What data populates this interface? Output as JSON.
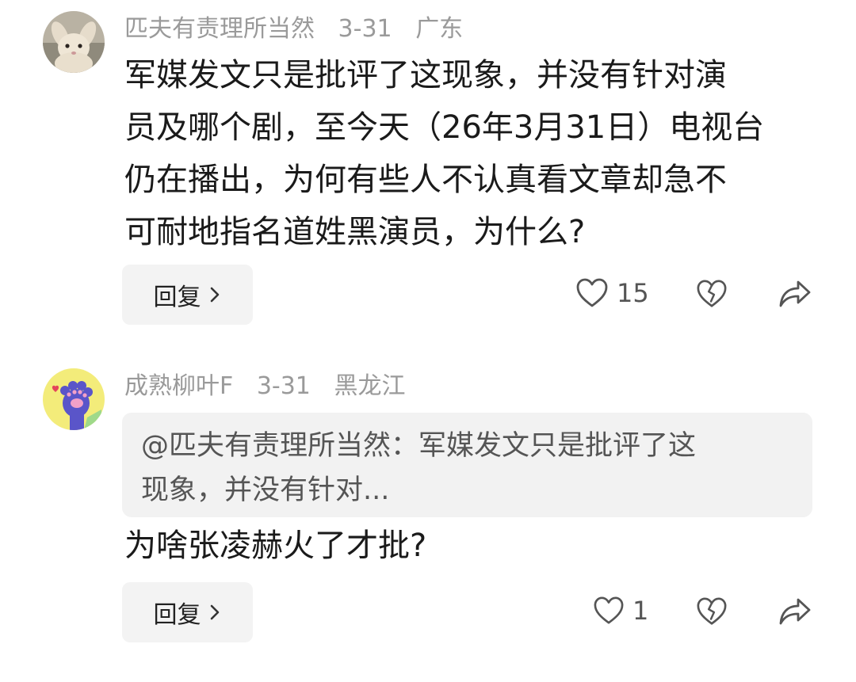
{
  "comments": [
    {
      "username": "匹夫有责理所当然",
      "date": "3-31",
      "location": "广东",
      "lines": [
        "军媒发文只是批评了这现象，并没有针对演",
        "员及哪个剧，至今天（26年3月31日）电视台",
        "仍在播出，为何有些人不认真看文章却急不",
        "可耐地指名道姓黑演员，为什么?"
      ],
      "reply_label": "回复",
      "like_count": "15",
      "avatar": "rabbit-photo"
    },
    {
      "username": "成熟柳叶F",
      "date": "3-31",
      "location": "黑龙江",
      "quote_lines": [
        "@匹夫有责理所当然：军媒发文只是批评了这",
        "现象，并没有针对..."
      ],
      "text": "为啥张凌赫火了才批?",
      "reply_label": "回复",
      "like_count": "1",
      "avatar": "paw-illustration"
    }
  ],
  "icons": {
    "like": "heart-outline-icon",
    "dislike": "broken-heart-icon",
    "share": "share-arrow-icon",
    "chevron": "chevron-right-icon"
  },
  "colors": {
    "meta_text": "#9a9a9a",
    "body_text": "#1a1a1a",
    "quote_bg": "#f2f2f2",
    "button_bg": "#f3f3f3",
    "paw_avatar_bg": "#f3ec7a",
    "paw_color": "#5a55c9"
  }
}
